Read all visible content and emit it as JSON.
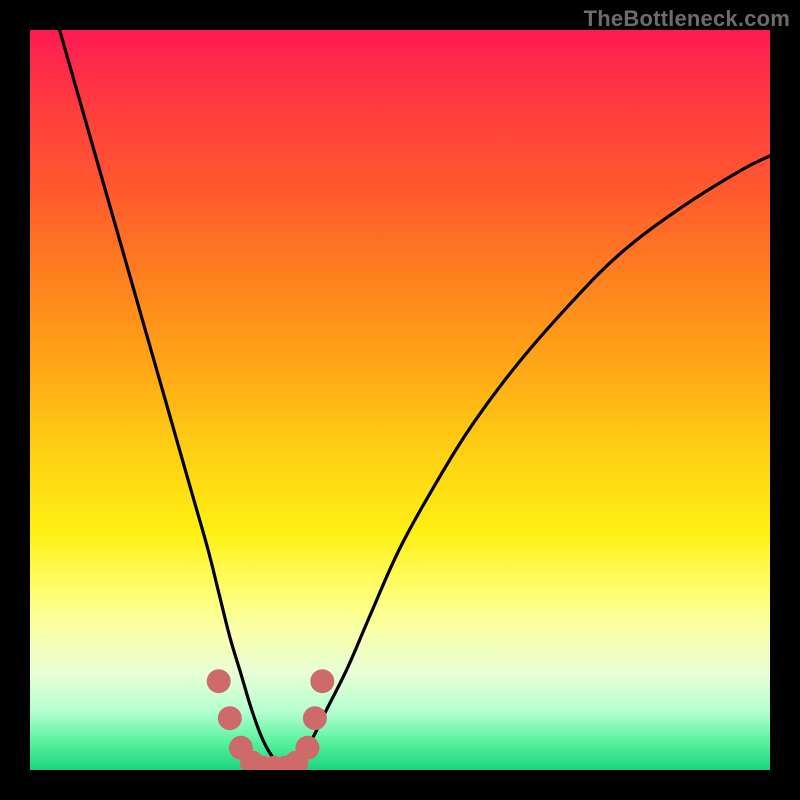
{
  "watermark": "TheBottleneck.com",
  "chart_data": {
    "type": "line",
    "title": "",
    "xlabel": "",
    "ylabel": "",
    "xlim": [
      0,
      100
    ],
    "ylim": [
      0,
      100
    ],
    "series": [
      {
        "name": "bottleneck-curve",
        "x": [
          4,
          6,
          8,
          10,
          12,
          14,
          16,
          18,
          20,
          22,
          24,
          25.5,
          27,
          28.5,
          30,
          31.5,
          33,
          34.5,
          36,
          38,
          40,
          43,
          46,
          50,
          55,
          60,
          66,
          73,
          80,
          88,
          96,
          100
        ],
        "y": [
          100,
          93,
          86,
          79,
          72,
          65,
          58,
          51,
          44,
          37,
          30,
          24,
          18,
          13,
          8,
          4,
          1.5,
          0.5,
          1.5,
          4,
          8,
          14,
          21,
          30,
          39,
          47,
          55,
          63,
          70,
          76,
          81,
          83
        ]
      }
    ],
    "markers": {
      "name": "optimal-region-dots",
      "x": [
        25.5,
        27,
        28.5,
        30,
        31.5,
        33,
        34.5,
        36,
        37.5,
        38.5,
        39.5
      ],
      "y": [
        12,
        7,
        3,
        1,
        0.3,
        0.3,
        0.3,
        1,
        3,
        7,
        12
      ],
      "color": "#cf6a6a",
      "radius_px": 12
    },
    "background_gradient": {
      "top_color": "#ff1a52",
      "bottom_color": "#1ad47e"
    }
  }
}
